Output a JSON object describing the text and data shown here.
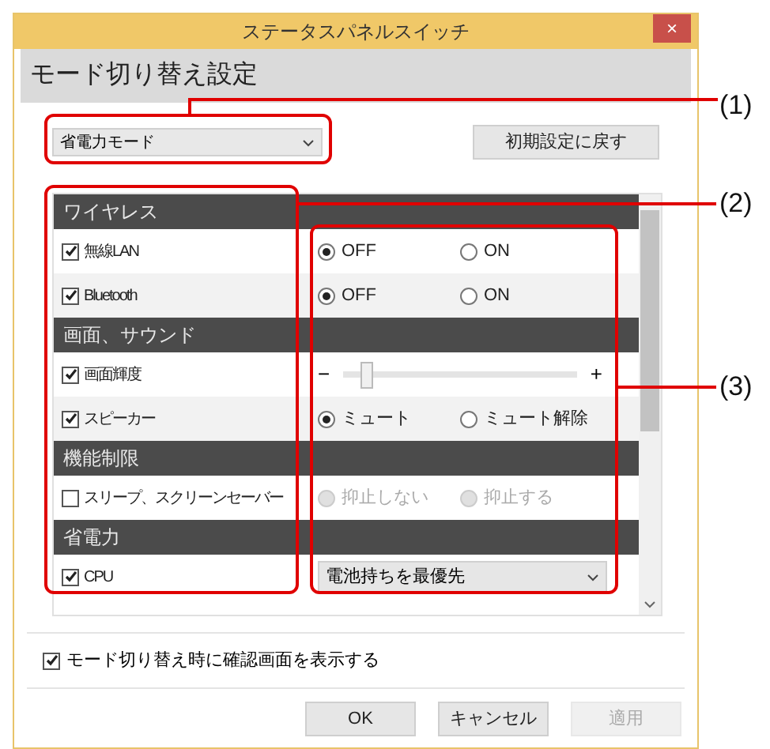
{
  "window": {
    "title": "ステータスパネルスイッチ",
    "close": "×"
  },
  "header": {
    "title": "モード切り替え設定"
  },
  "mode_select": {
    "value": "省電力モード"
  },
  "reset_button": {
    "label": "初期設定に戻す"
  },
  "sections": [
    {
      "title": "ワイヤレス",
      "rows": [
        {
          "kind": "radio",
          "label": "無線LAN",
          "checked": true,
          "options": [
            {
              "label": "OFF",
              "selected": true,
              "disabled": false
            },
            {
              "label": "ON",
              "selected": false,
              "disabled": false
            }
          ]
        },
        {
          "kind": "radio",
          "label": "Bluetooth",
          "checked": true,
          "options": [
            {
              "label": "OFF",
              "selected": true,
              "disabled": false
            },
            {
              "label": "ON",
              "selected": false,
              "disabled": false
            }
          ]
        }
      ]
    },
    {
      "title": "画面、サウンド",
      "rows": [
        {
          "kind": "slider",
          "label": "画面輝度",
          "checked": true,
          "minus": "−",
          "plus": "+",
          "level": 0.08
        },
        {
          "kind": "radio",
          "label": "スピーカー",
          "checked": true,
          "options": [
            {
              "label": "ミュート",
              "selected": true,
              "disabled": false
            },
            {
              "label": "ミュート解除",
              "selected": false,
              "disabled": false
            }
          ]
        }
      ]
    },
    {
      "title": "機能制限",
      "rows": [
        {
          "kind": "radio",
          "label": "スリープ、スクリーンセーバー",
          "checked": false,
          "options": [
            {
              "label": "抑止しない",
              "selected": false,
              "disabled": true
            },
            {
              "label": "抑止する",
              "selected": false,
              "disabled": true
            }
          ]
        }
      ]
    },
    {
      "title": "省電力",
      "rows": [
        {
          "kind": "select",
          "label": "CPU",
          "checked": true,
          "value": "電池持ちを最優先"
        }
      ]
    }
  ],
  "confirm_checkbox": {
    "label": "モード切り替え時に確認画面を表示する",
    "checked": true
  },
  "buttons": [
    {
      "label": "OK",
      "disabled": false
    },
    {
      "label": "キャンセル",
      "disabled": false
    },
    {
      "label": "適用",
      "disabled": true
    }
  ],
  "callouts": [
    {
      "label": "(1)"
    },
    {
      "label": "(2)"
    },
    {
      "label": "(3)"
    }
  ]
}
